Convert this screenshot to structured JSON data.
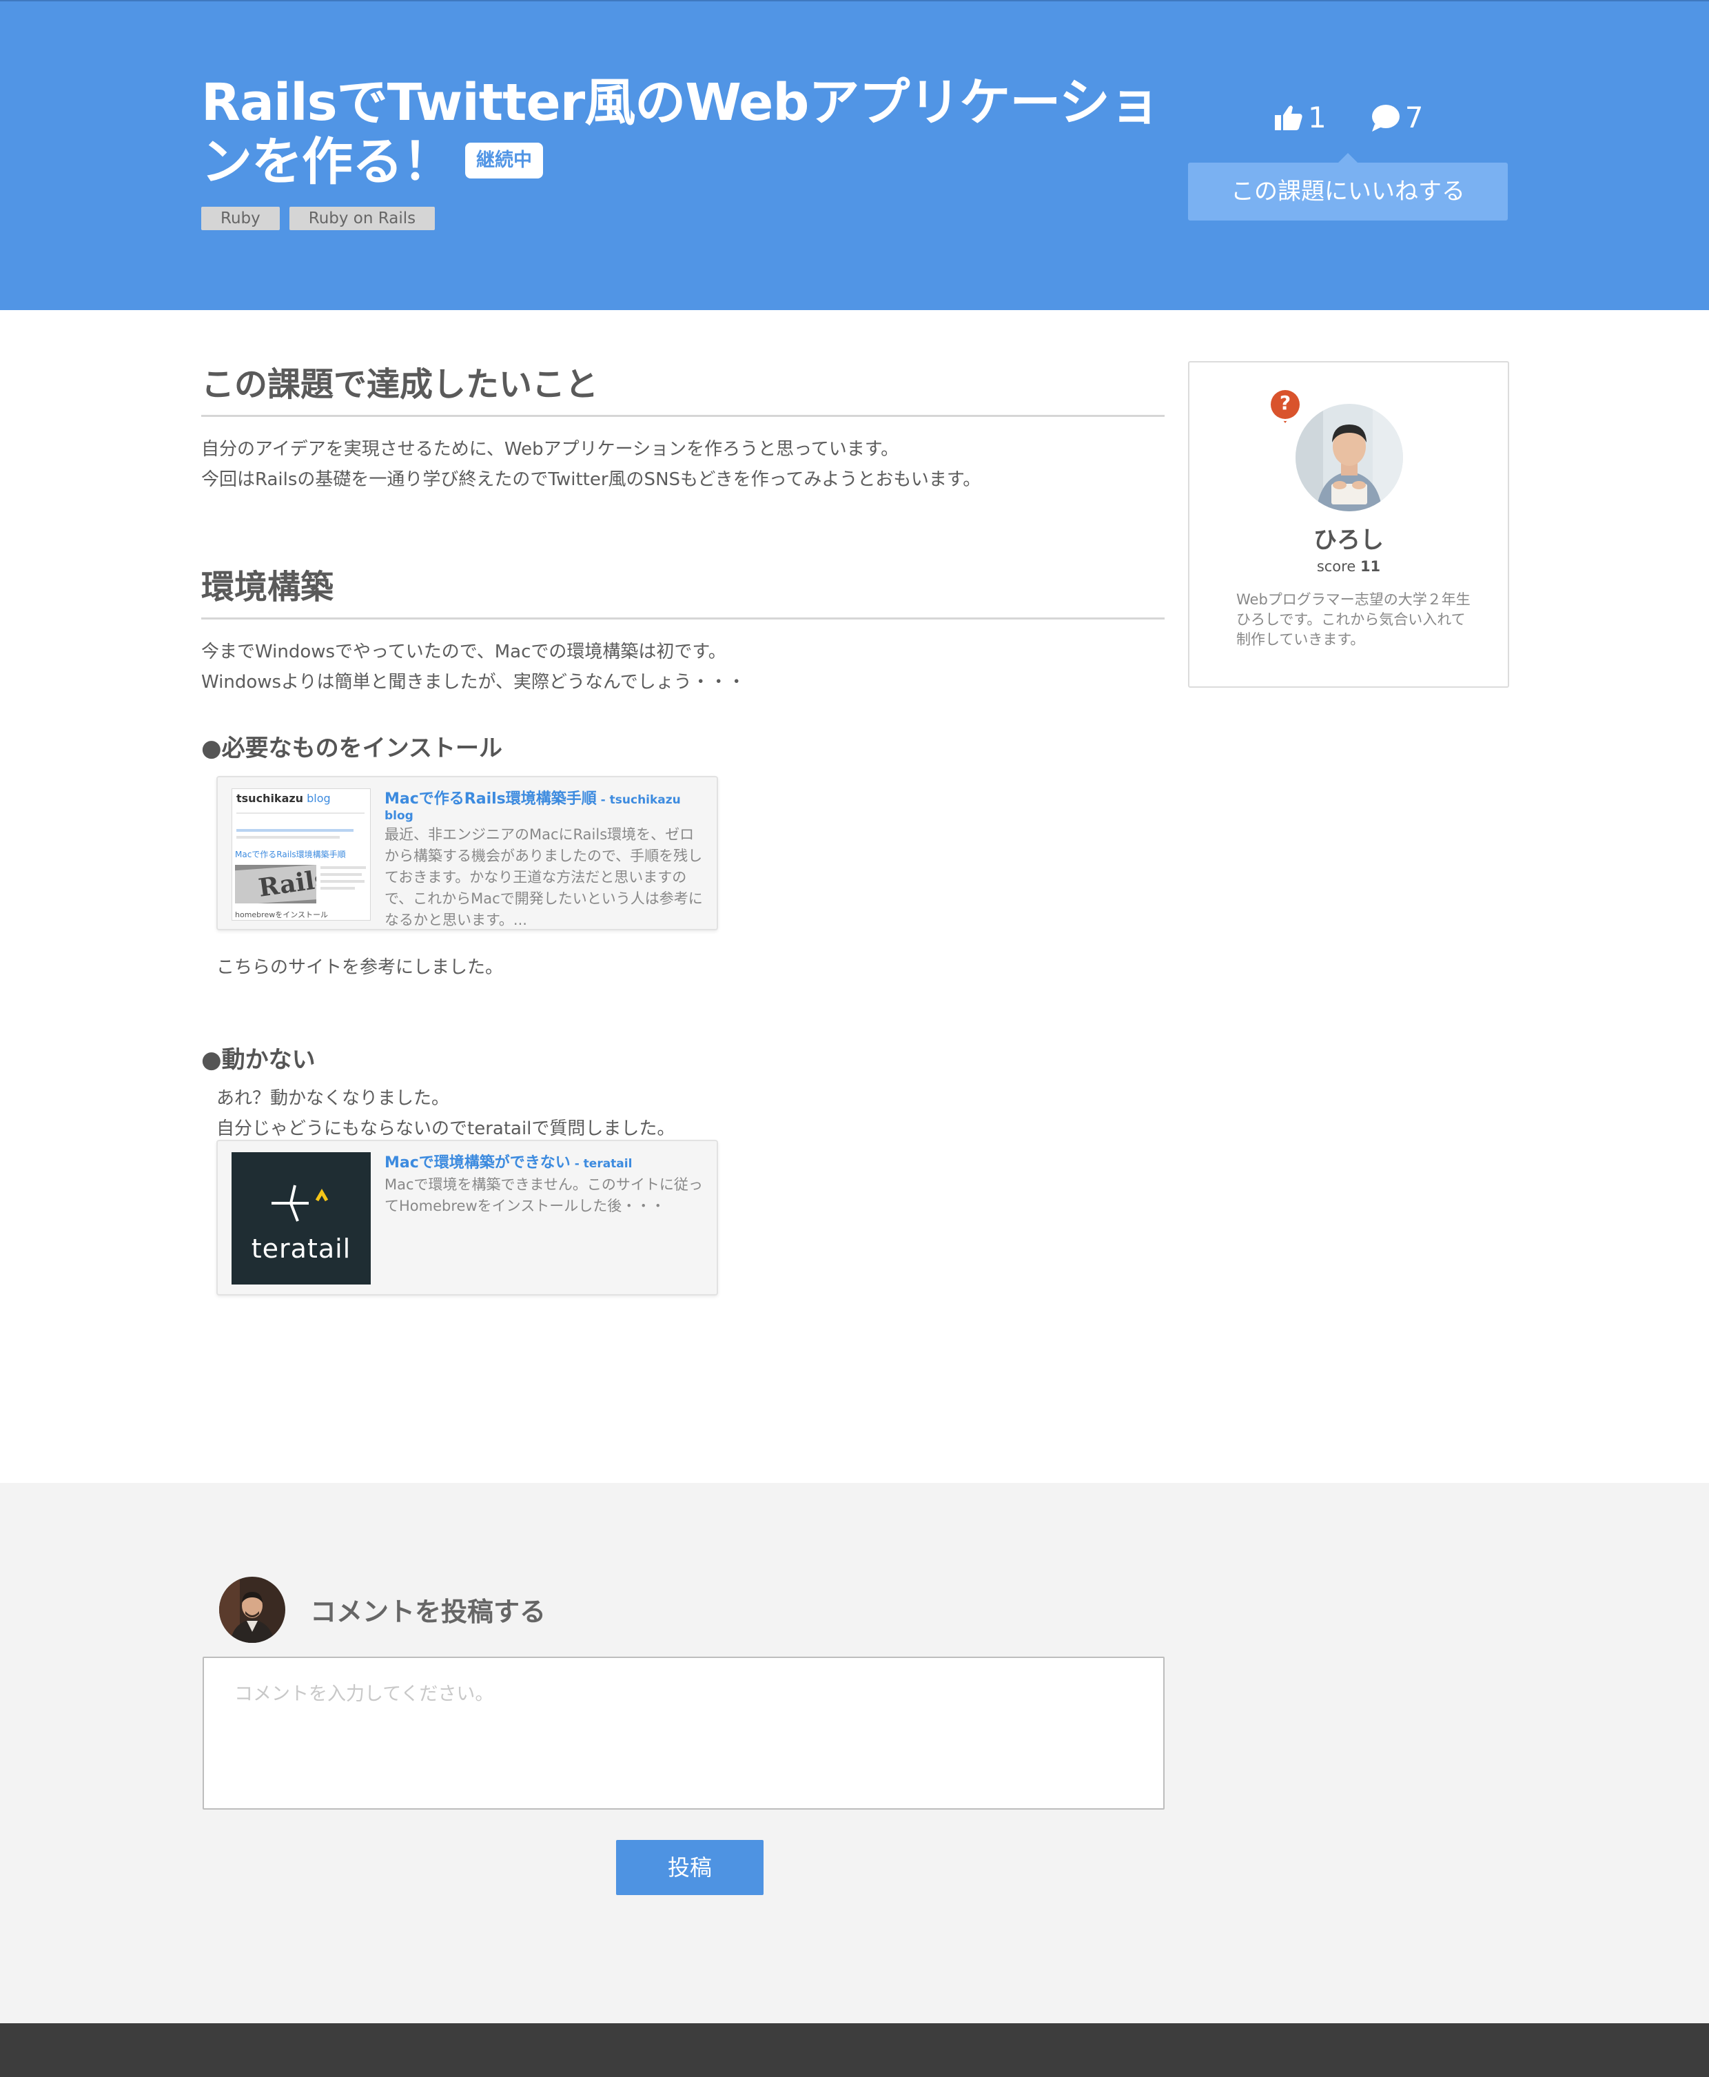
{
  "header": {
    "title": "RailsでTwitter風のWebアプリケーションを作る！",
    "status_badge": "継続中",
    "tags": [
      "Ruby",
      "Ruby on Rails"
    ],
    "likes_count": "1",
    "comments_count": "7",
    "like_button": "この課題にいいねする",
    "colors": {
      "background": "#5195e5",
      "button": "#7ab1f2"
    }
  },
  "sections": {
    "goal": {
      "heading": "この課題で達成したいこと",
      "lines": [
        "自分のアイデアを実現させるために、Webアプリケーションを作ろうと思っています。",
        "今回はRailsの基礎を一通り学び終えたのでTwitter風のSNSもどきを作ってみようとおもいます。"
      ]
    },
    "env": {
      "heading": "環境構築",
      "lines": [
        "今までWindowsでやっていたので、Macでの環境構築は初です。",
        "Windowsよりは簡単と聞きましたが、実際どうなんでしょう・・・"
      ]
    },
    "install": {
      "subheading": "●必要なものをインストール",
      "card": {
        "title": "Macで作るRails環境構築手順",
        "source": " - tsuchikazu blog",
        "description": "最近、非エンジニアのMacにRails環境を、ゼロから構築する機会がありましたので、手順を残しておきます。かなり王道な方法だと思いますので、これからMacで開発したいという人は参考になるかと思います。...",
        "thumb_brand": "tsuchikazu",
        "thumb_brand_suffix": " blog",
        "thumb_heading": "Macで作るRails環境構築手順",
        "thumb_footer": "homebrewをインストール",
        "thumb_photo_text": "Rails"
      },
      "note": "こちらのサイトを参考にしました。"
    },
    "broken": {
      "subheading": "●動かない",
      "lines": [
        "あれ？動かなくなりました。",
        "自分じゃどうにもならないのでteratailで質問しました。"
      ],
      "card": {
        "title": "Macで環境構築ができない",
        "source": " - teratail",
        "description": "Macで環境を構築できません。このサイトに従ってHomebrewをインストールした後・・・",
        "logo_text": "teratail"
      }
    }
  },
  "profile": {
    "name": "ひろし",
    "score_label": "score",
    "score_value": "11",
    "bio": "Webプログラマー志望の大学２年生ひろしです。これから気合い入れて制作していきます。",
    "question_badge": "?"
  },
  "comment": {
    "heading": "コメントを投稿する",
    "placeholder": "コメントを入力してください。",
    "submit": "投稿"
  }
}
